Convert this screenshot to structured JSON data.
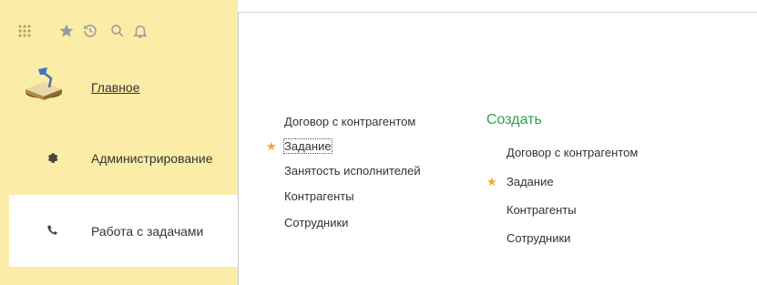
{
  "colors": {
    "sidebar_bg": "#fbeca8",
    "active_section_bg": "#ffffff",
    "create_title": "#2e9e52",
    "star": "#f5a623"
  },
  "toolbar": {
    "icons": [
      "grid-icon",
      "star-icon",
      "history-icon",
      "search-icon",
      "bell-icon"
    ]
  },
  "sidebar": {
    "sections": [
      {
        "label": "Главное",
        "icon": "desk-lamp-icon",
        "active": false
      },
      {
        "label": "Администрирование",
        "icon": "gear-icon",
        "active": false
      },
      {
        "label": "Работа с задачами",
        "icon": "phone-icon",
        "active": true
      }
    ]
  },
  "main": {
    "list": [
      {
        "label": "Договор с контрагентом",
        "starred": false
      },
      {
        "label": "Задание",
        "starred": true
      },
      {
        "label": "Занятость исполнителей",
        "starred": false
      },
      {
        "label": "Контрагенты",
        "starred": false
      },
      {
        "label": "Сотрудники",
        "starred": false
      }
    ],
    "create": {
      "title": "Создать",
      "items": [
        {
          "label": "Договор с контрагентом",
          "starred": false
        },
        {
          "label": "Задание",
          "starred": true
        },
        {
          "label": "Контрагенты",
          "starred": false
        },
        {
          "label": "Сотрудники",
          "starred": false
        }
      ]
    }
  }
}
